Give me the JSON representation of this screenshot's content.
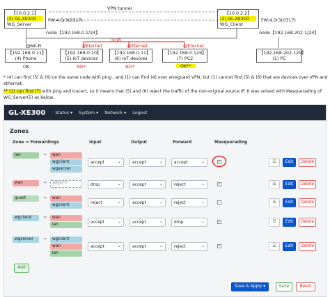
{
  "diagram": {
    "server": {
      "ip": "【10.0.2.1】",
      "name": "(3) GL-XE300",
      "fw": "FW:4.0r3(0317)",
      "tag": "WG_Server"
    },
    "client": {
      "ip": "【10.0.2.2】",
      "name": "(2) GL-XE300",
      "fw": "FW:4.0r3(0317)",
      "tag": "WG_Client"
    },
    "vpn_label": "VPN tunnel",
    "node_left": "node【192.168.0.1/24】",
    "node_right": "node【192.168.202.1/24】",
    "hub": "HUB",
    "wifi": "@Wi-Fi",
    "eth1": "@Eternet",
    "eth2": "@Eternet",
    "eth3": "@Eternet",
    "dev1": {
      "ip": "【192.168.0.11】",
      "name": "(4) Phone",
      "status": "OK"
    },
    "dev2": {
      "ip": "【192.168.0.10】",
      "name": "(5) IoT devices",
      "status": "NG*"
    },
    "dev3": {
      "ip": "【192.168.0.11】",
      "name": "(6) IoT devices",
      "status": "NG*"
    },
    "dev4": {
      "ip": "【192.168.0.129】",
      "name": "(7) PC2",
      "status": "OK**"
    },
    "dev5": {
      "ip": "【192.168.202.129】",
      "name": "(1) PC"
    }
  },
  "notes": {
    "n1": "* (4) can find (5) & (6) on the same node with ping , and (1) can find (4) over wireguard VPN, but (1) cannot find (5) & (6) that are devices over VPN and ethernet.",
    "n2_hl": "** (1) can find (7)",
    "n2": " with ping and tracert, so it means that (5) and (6) reject the traffic of the non-original source IP. It was solved with Masquerading of WG_Server(5) as below."
  },
  "app": {
    "brand": "GL-XE300",
    "menu": [
      "Status ▾",
      "System ▾",
      "Network ▾",
      "Logout"
    ],
    "zones_title": "Zones",
    "headers": {
      "zone": "Zone ⇒ Forwardings",
      "input": "Input",
      "output": "Output",
      "forward": "Forward",
      "masq": "Masquerading"
    },
    "rows": [
      {
        "zone": "lan",
        "fwd": [
          "wan",
          "wgclient",
          "wgserver"
        ],
        "input": "accept",
        "output": "accept",
        "forward": "accept",
        "masq": true
      },
      {
        "zone": "wan",
        "fwd": [
          "REJECT"
        ],
        "input": "drop",
        "output": "accept",
        "forward": "reject",
        "masq": true
      },
      {
        "zone": "guest",
        "fwd": [
          "wan",
          "wgclient"
        ],
        "input": "reject",
        "output": "accept",
        "forward": "reject",
        "masq": false
      },
      {
        "zone": "wgclient",
        "fwd": [
          "wan",
          "lan"
        ],
        "input": "accept",
        "output": "accept",
        "forward": "drop",
        "masq": true
      },
      {
        "zone": "wgserver",
        "fwd": [
          "wgclient",
          "wan",
          "lan"
        ],
        "input": "accept",
        "output": "accept",
        "forward": "reject",
        "masq": true
      }
    ],
    "drag_label": "☰",
    "edit_label": "Edit",
    "delete_label": "Delete",
    "add_label": "Add",
    "save_apply_label": "Save & Apply",
    "save_apply_caret": "▾",
    "save_label": "Save",
    "reset_label": "Reset"
  }
}
